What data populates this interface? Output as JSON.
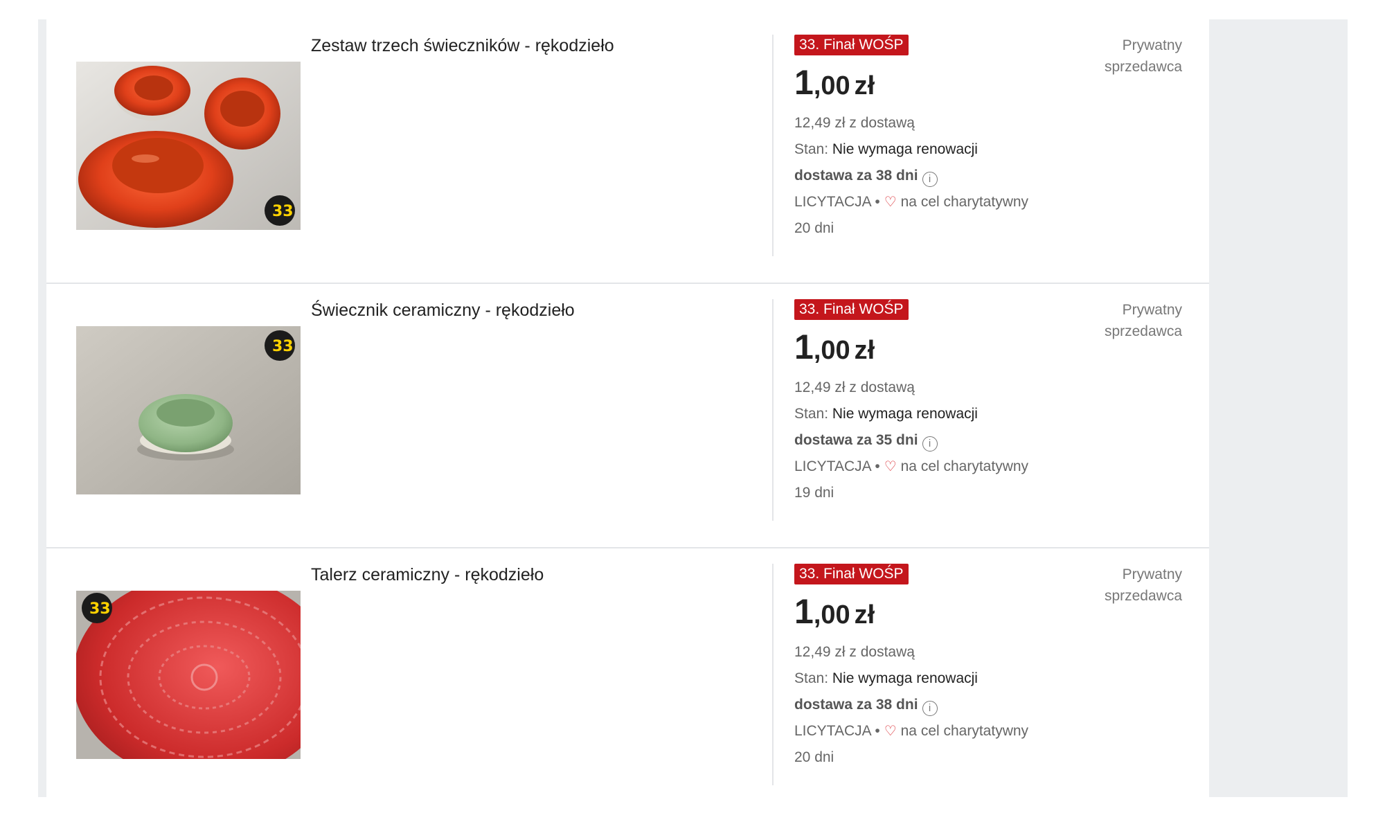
{
  "listings": [
    {
      "title": "Zestaw trzech świeczników - rękodzieło",
      "image_icon": "three-red-ceramic-candle-holders",
      "badge": "33. Finał WOŚP",
      "price_int": "1",
      "price_dec": ",00",
      "currency": "zł",
      "with_delivery": "12,49 zł z dostawą",
      "condition_label": "Stan:",
      "condition_value": "Nie wymaga renowacji",
      "delivery": "dostawa za 38 dni",
      "auction": "LICYTACJA",
      "separator": "•",
      "charity": "na cel charytatywny",
      "time_left": "20 dni",
      "seller_line1": "Prywatny",
      "seller_line2": "sprzedawca"
    },
    {
      "title": "Świecznik ceramiczny - rękodzieło",
      "image_icon": "green-ceramic-candle-holder",
      "badge": "33. Finał WOŚP",
      "price_int": "1",
      "price_dec": ",00",
      "currency": "zł",
      "with_delivery": "12,49 zł z dostawą",
      "condition_label": "Stan:",
      "condition_value": "Nie wymaga renowacji",
      "delivery": "dostawa za 35 dni",
      "auction": "LICYTACJA",
      "separator": "•",
      "charity": "na cel charytatywny",
      "time_left": "19 dni",
      "seller_line1": "Prywatny",
      "seller_line2": "sprzedawca"
    },
    {
      "title": "Talerz ceramiczny - rękodzieło",
      "image_icon": "red-ceramic-plate",
      "badge": "33. Finał WOŚP",
      "price_int": "1",
      "price_dec": ",00",
      "currency": "zł",
      "with_delivery": "12,49 zł z dostawą",
      "condition_label": "Stan:",
      "condition_value": "Nie wymaga renowacji",
      "delivery": "dostawa za 38 dni",
      "auction": "LICYTACJA",
      "separator": "•",
      "charity": "na cel charytatywny",
      "time_left": "20 dni",
      "seller_line1": "Prywatny",
      "seller_line2": "sprzedawca"
    }
  ],
  "icons": {
    "info": "info-icon",
    "heart": "heart-icon",
    "wosp_logo": "wosp-33-logo"
  },
  "colors": {
    "badge_bg": "#c4161c",
    "heart": "#d8232a",
    "rail": "#eceef0"
  }
}
